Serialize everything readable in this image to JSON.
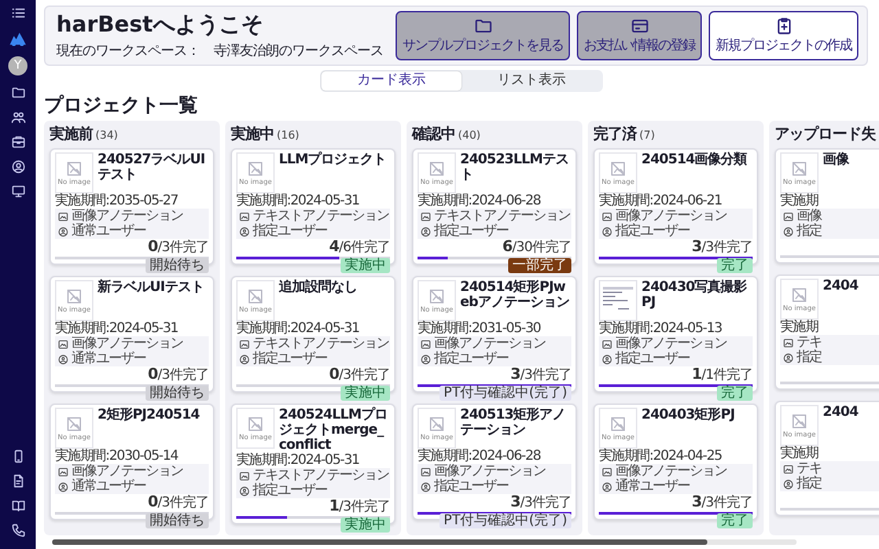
{
  "sidebar": {
    "avatar": "Y"
  },
  "header": {
    "title": "harBestへようこそ",
    "workspace_label": "現在のワークスペース：",
    "workspace_name": "寺澤友治朗のワークスペース",
    "buttons": [
      {
        "label": "サンプルプロジェクトを見る",
        "kind": "shaded"
      },
      {
        "label": "お支払い情報の登録",
        "kind": "shaded"
      },
      {
        "label": "新規プロジェクトの作成",
        "kind": "outline"
      }
    ]
  },
  "view_toggle": [
    {
      "label": "カード表示",
      "selected": true
    },
    {
      "label": "リスト表示",
      "selected": false
    }
  ],
  "heading": "プロジェクト一覧",
  "columns": [
    {
      "title": "実施前",
      "count": "(34)",
      "cards": [
        {
          "title": "240527ラベルUIテスト",
          "deadline": "実施期間:2035-05-27",
          "thumbnail": {
            "kind": "empty",
            "label": "No image"
          },
          "tags": [
            {
              "kind": "task",
              "label": "画像アノテーション"
            },
            {
              "kind": "user",
              "label": "通常ユーザー"
            }
          ],
          "progress": "**0**/3件完了",
          "level": 0,
          "status": {
            "kind": "waiting",
            "label": "開始待ち"
          }
        },
        {
          "title": "新ラベルUIテスト",
          "deadline": "実施期間:2024-05-31",
          "thumbnail": {
            "kind": "empty",
            "label": "No image"
          },
          "tags": [
            {
              "kind": "task",
              "label": "画像アノテーション"
            },
            {
              "kind": "user",
              "label": "通常ユーザー"
            }
          ],
          "progress": "**0**/3件完了",
          "level": 0,
          "status": {
            "kind": "waiting",
            "label": "開始待ち"
          }
        },
        {
          "title": "2矩形PJ240514",
          "deadline": "実施期間:2030-05-14",
          "thumbnail": {
            "kind": "empty",
            "label": "No image"
          },
          "tags": [
            {
              "kind": "task",
              "label": "画像アノテーション"
            },
            {
              "kind": "user",
              "label": "通常ユーザー"
            }
          ],
          "progress": "**0**/3件完了",
          "level": 0,
          "status": {
            "kind": "waiting",
            "label": "開始待ち"
          }
        }
      ]
    },
    {
      "title": "実施中",
      "count": "(16)",
      "cards": [
        {
          "title": "LLMプロジェクト",
          "deadline": "実施期間:2024-05-31",
          "thumbnail": {
            "kind": "empty",
            "label": "No image"
          },
          "tags": [
            {
              "kind": "task",
              "label": "テキストアノテーション"
            },
            {
              "kind": "user",
              "label": "指定ユーザー"
            }
          ],
          "progress": "**4**/6件完了",
          "level": 0.67,
          "status": {
            "kind": "active",
            "label": "実施中"
          }
        },
        {
          "title": "追加設問なし",
          "deadline": "実施期間:2024-05-31",
          "thumbnail": {
            "kind": "empty",
            "label": "No image"
          },
          "tags": [
            {
              "kind": "task",
              "label": "テキストアノテーション"
            },
            {
              "kind": "user",
              "label": "指定ユーザー"
            }
          ],
          "progress": "**0**/3件完了",
          "level": 0,
          "status": {
            "kind": "active",
            "label": "実施中"
          }
        },
        {
          "title": "240524LLMプロジェクトmerge_conflict",
          "deadline": "実施期間:2024-05-31",
          "thumbnail": {
            "kind": "empty",
            "label": "No image"
          },
          "tags": [
            {
              "kind": "task",
              "label": "テキストアノテーション"
            },
            {
              "kind": "user",
              "label": "指定ユーザー"
            }
          ],
          "progress": "**1**/3件完了",
          "level": 0.33,
          "status": {
            "kind": "active",
            "label": "実施中"
          }
        }
      ]
    },
    {
      "title": "確認中",
      "count": "(40)",
      "cards": [
        {
          "title": "240523LLMテスト",
          "deadline": "実施期間:2024-06-28",
          "thumbnail": {
            "kind": "empty",
            "label": "No image"
          },
          "tags": [
            {
              "kind": "task",
              "label": "テキストアノテーション"
            },
            {
              "kind": "user",
              "label": "指定ユーザー"
            }
          ],
          "progress": "**6**/30件完了",
          "level": 0.2,
          "status": {
            "kind": "partial",
            "label": "一部完了"
          }
        },
        {
          "title": "240514矩形PJwebアノテーション",
          "deadline": "実施期間:2031-05-30",
          "thumbnail": {
            "kind": "empty",
            "label": "No image"
          },
          "tags": [
            {
              "kind": "task",
              "label": "画像アノテーション"
            },
            {
              "kind": "user",
              "label": "指定ユーザー"
            }
          ],
          "progress": "**3**/3件完了",
          "level": 1,
          "status": {
            "kind": "confirming",
            "label": "PT付与確認中(完了)"
          }
        },
        {
          "title": "240513矩形アノテーション",
          "deadline": "実施期間:2024-06-28",
          "thumbnail": {
            "kind": "empty",
            "label": "No image"
          },
          "tags": [
            {
              "kind": "task",
              "label": "画像アノテーション"
            },
            {
              "kind": "user",
              "label": "指定ユーザー"
            }
          ],
          "progress": "**3**/3件完了",
          "level": 1,
          "status": {
            "kind": "confirming",
            "label": "PT付与確認中(完了)"
          }
        }
      ]
    },
    {
      "title": "完了済",
      "count": "(7)",
      "cards": [
        {
          "title": "240514画像分類",
          "deadline": "実施期間:2024-06-21",
          "thumbnail": {
            "kind": "empty",
            "label": "No image"
          },
          "tags": [
            {
              "kind": "task",
              "label": "画像アノテーション"
            },
            {
              "kind": "user",
              "label": "指定ユーザー"
            }
          ],
          "progress": "**3**/3件完了",
          "level": 1,
          "status": {
            "kind": "done",
            "label": "完了"
          }
        },
        {
          "title": "240430写真撮影PJ",
          "deadline": "実施期間:2024-05-13",
          "thumbnail": {
            "kind": "preview"
          },
          "tags": [
            {
              "kind": "task",
              "label": "画像アノテーション"
            },
            {
              "kind": "user",
              "label": "指定ユーザー"
            }
          ],
          "progress": "**1**/1件完了",
          "level": 1,
          "status": {
            "kind": "done",
            "label": "完了"
          }
        },
        {
          "title": "240403矩形PJ",
          "deadline": "実施期間:2024-04-25",
          "thumbnail": {
            "kind": "empty",
            "label": "No image"
          },
          "tags": [
            {
              "kind": "task",
              "label": "画像アノテーション"
            },
            {
              "kind": "user",
              "label": "通常ユーザー"
            }
          ],
          "progress": "**3**/3件完了",
          "level": 1,
          "status": {
            "kind": "done",
            "label": "完了"
          }
        }
      ]
    },
    {
      "title": "アップロード失",
      "cards": [
        {
          "title": "画像",
          "deadline": "実施期",
          "thumbnail": {
            "kind": "empty",
            "label": "No image"
          },
          "tags": [
            {
              "kind": "task",
              "label": "画像"
            },
            {
              "kind": "user",
              "label": "指定"
            }
          ],
          "level": 0
        },
        {
          "title": "2404",
          "deadline": "実施期",
          "thumbnail": {
            "kind": "empty",
            "label": "No image"
          },
          "tags": [
            {
              "kind": "task",
              "label": "テキ"
            },
            {
              "kind": "user",
              "label": "指定"
            }
          ],
          "level": 0
        },
        {
          "title": "2404",
          "deadline": "実施期",
          "thumbnail": {
            "kind": "empty",
            "label": "No image"
          },
          "tags": [
            {
              "kind": "task",
              "label": "テキ"
            },
            {
              "kind": "user",
              "label": "指定"
            }
          ],
          "level": 0
        }
      ]
    }
  ]
}
